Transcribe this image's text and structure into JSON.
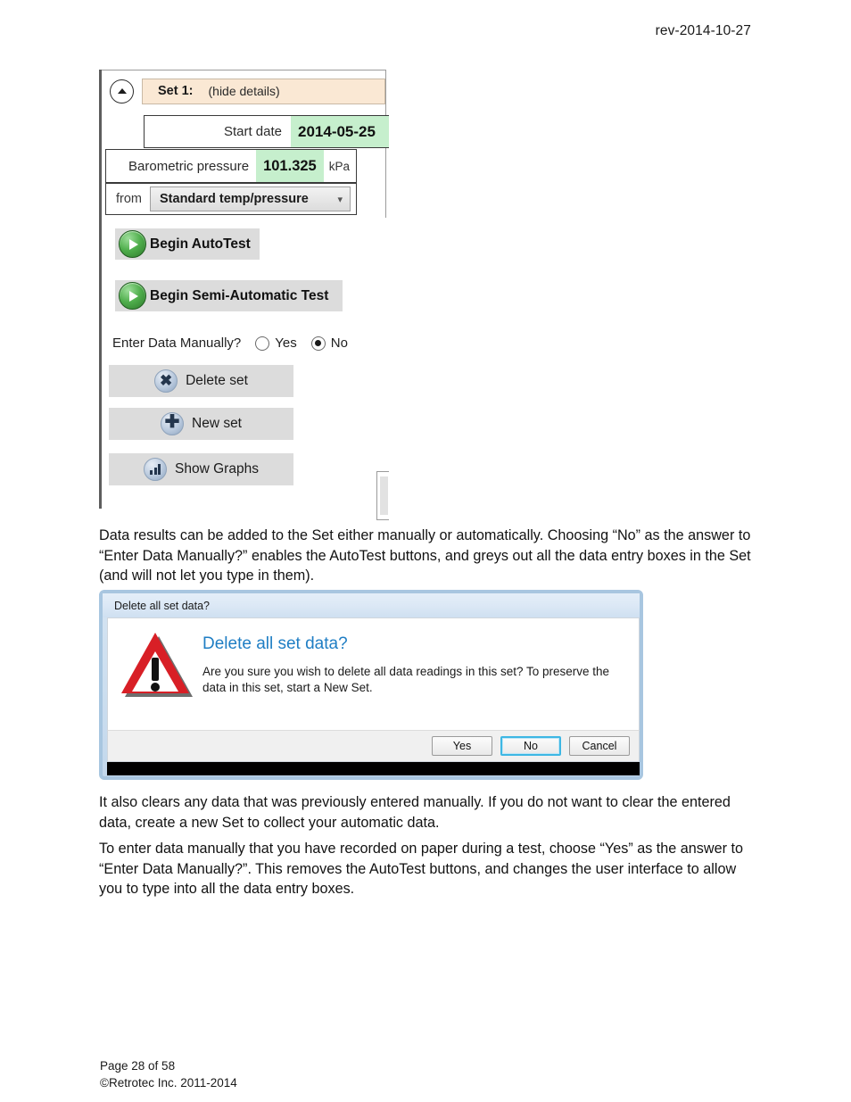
{
  "header": {
    "revision": "rev-2014-10-27"
  },
  "set_panel": {
    "collapse_icon": "chevron-up-icon",
    "set_label": "Set 1:",
    "hide_details": "(hide details)",
    "start_date": {
      "label": "Start date",
      "value": "2014-05-25"
    },
    "barometric_pressure": {
      "label": "Barometric pressure",
      "value": "101.325",
      "unit": "kPa"
    },
    "from": {
      "label": "from",
      "selected": "Standard temp/pressure",
      "arrow_icon": "chevron-down-icon"
    },
    "buttons": {
      "begin_autotest": "Begin AutoTest",
      "begin_semi_automatic": "Begin Semi-Automatic Test",
      "play_icon": "play-icon"
    },
    "enter_data_manually": {
      "label": "Enter Data Manually?",
      "options": [
        "Yes",
        "No"
      ],
      "selected": "No"
    },
    "list_buttons": [
      {
        "label": "Delete set",
        "icon": "x-circle-icon"
      },
      {
        "label": "New set",
        "icon": "plus-circle-icon"
      },
      {
        "label": "Show Graphs",
        "icon": "bar-chart-icon"
      }
    ],
    "colors": {
      "header_bg": "#fae8d4",
      "value_bg": "#c6efcd",
      "button_bg": "#dcdcdc"
    }
  },
  "body": {
    "paragraph_1": "Data results can be added to the Set either manually or automatically.  Choosing “No” as the answer to “Enter Data Manually?”  enables the AutoTest buttons, and greys out all the data entry boxes in the Set (and will not let you type in them).",
    "paragraph_2": "It also clears any data that was previously entered manually.  If you do not want to clear the entered data, create a new Set to collect your automatic data.",
    "paragraph_3": "To enter data manually that you have recorded on paper during a test,  choose “Yes” as the answer to “Enter Data Manually?”.  This removes the AutoTest buttons, and changes the user interface to allow you to type into all the data entry boxes."
  },
  "dialog": {
    "titlebar": "Delete all set data?",
    "warning_icon": "warning-triangle-icon",
    "heading": "Delete all set data?",
    "message": "Are you sure you wish to delete all data readings in this set? To preserve the data in this set, start a New Set.",
    "buttons": [
      {
        "label": "Yes",
        "focused": false
      },
      {
        "label": "No",
        "focused": true
      },
      {
        "label": "Cancel",
        "focused": false
      }
    ],
    "heading_color": "#1f7ec4"
  },
  "footer": {
    "page": "Page 28 of 58",
    "copyright": "©Retrotec Inc. 2011-2014"
  }
}
